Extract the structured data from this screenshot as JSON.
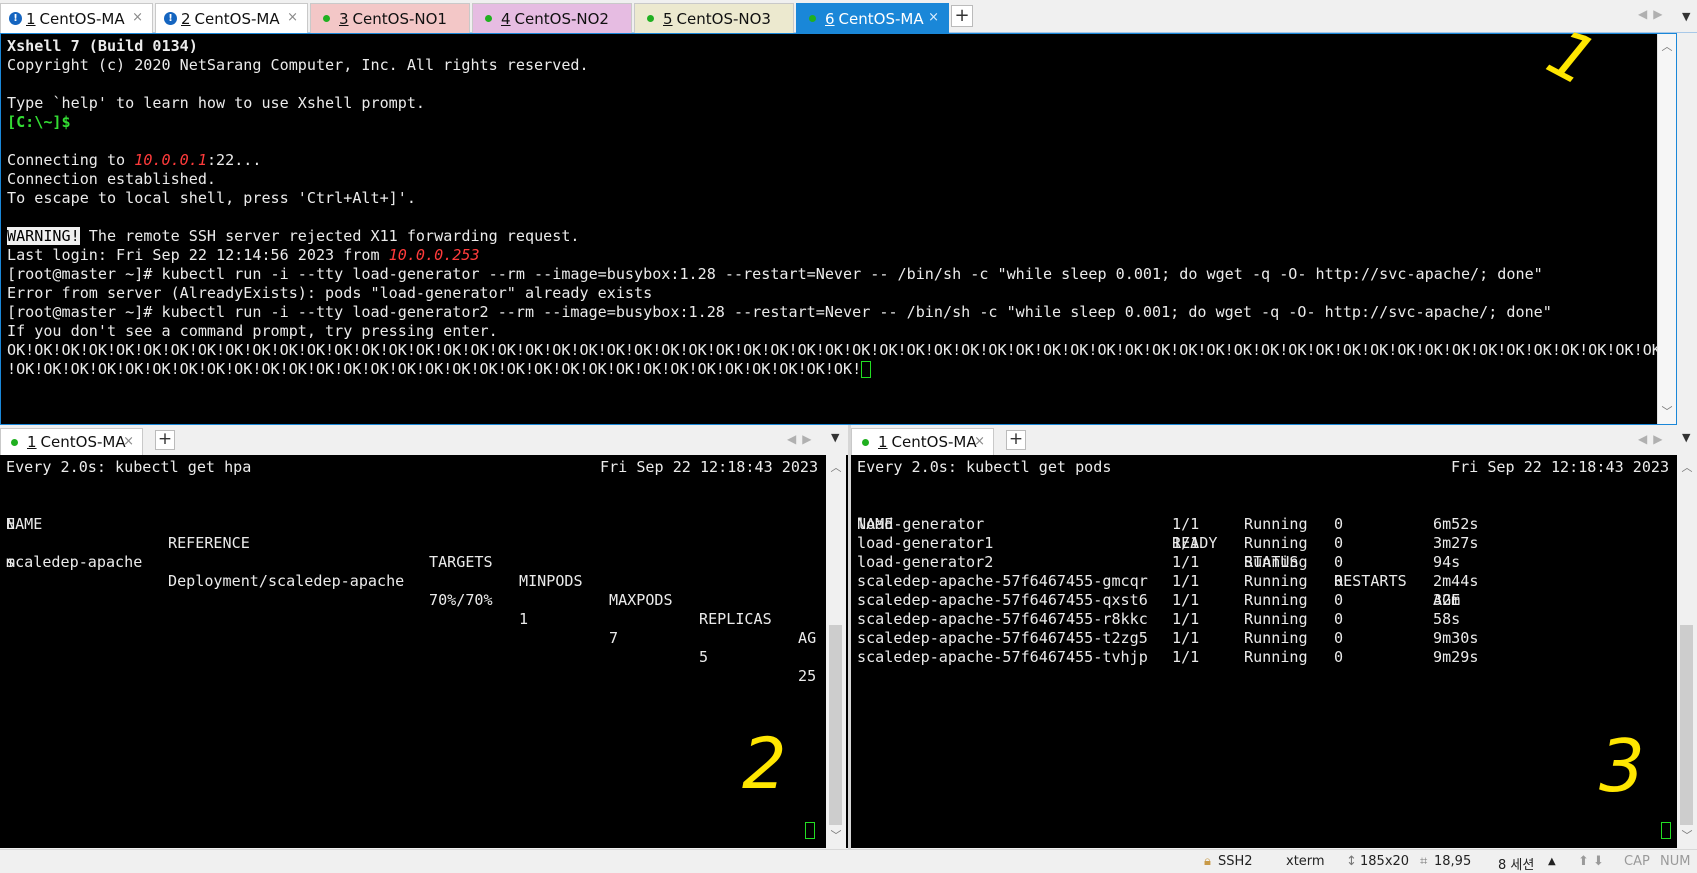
{
  "top_tabs": [
    {
      "num": "1",
      "label": "CentOS-MA",
      "bg": "#ffffff",
      "indicator": "alert-icon"
    },
    {
      "num": "2",
      "label": "CentOS-MA",
      "bg": "#ffffff",
      "indicator": "alert-icon"
    },
    {
      "num": "3",
      "label": "CentOS-NO1",
      "bg": "#f3c7c7",
      "indicator": "green-dot"
    },
    {
      "num": "4",
      "label": "CentOS-NO2",
      "bg": "#e6bce2",
      "indicator": "green-dot"
    },
    {
      "num": "5",
      "label": "CentOS-NO3",
      "bg": "#ece9cf",
      "indicator": "green-dot"
    },
    {
      "num": "6",
      "label": "CentOS-MA",
      "bg": "#1a87d8",
      "indicator": "green-dot",
      "active": true
    }
  ],
  "tab_close": "×",
  "tab_add": "+",
  "terminal1": {
    "header_line1": "Xshell 7 (Build 0134)",
    "header_line2": "Copyright (c) 2020 NetSarang Computer, Inc. All rights reserved.",
    "help_line": "Type `help' to learn how to use Xshell prompt.",
    "local_prompt": "[C:\\~]$",
    "connecting_prefix": "Connecting to ",
    "connecting_host": "10.0.0.1",
    "connecting_suffix": ":22...",
    "established": "Connection established.",
    "escape": "To escape to local shell, press 'Ctrl+Alt+]'.",
    "warning_tag": "WARNING!",
    "warning_text": " The remote SSH server rejected X11 forwarding request.",
    "last_login_prefix": "Last login: Fri Sep 22 12:14:56 2023 from ",
    "last_login_host": "10.0.0.253",
    "cmd1": "[root@master ~]# kubectl run -i --tty load-generator --rm --image=busybox:1.28 --restart=Never -- /bin/sh -c \"while sleep 0.001; do wget -q -O- http://svc-apache/; done\"",
    "error1": "Error from server (AlreadyExists): pods \"load-generator\" already exists",
    "cmd2": "[root@master ~]# kubectl run -i --tty load-generator2 --rm --image=busybox:1.28 --restart=Never -- /bin/sh -c \"while sleep 0.001; do wget -q -O- http://svc-apache/; done\"",
    "hint": "If you don't see a command prompt, try pressing enter.",
    "ok_line1": "OK!OK!OK!OK!OK!OK!OK!OK!OK!OK!OK!OK!OK!OK!OK!OK!OK!OK!OK!OK!OK!OK!OK!OK!OK!OK!OK!OK!OK!OK!OK!OK!OK!OK!OK!OK!OK!OK!OK!OK!OK!OK!OK!OK!OK!OK!OK!OK!OK!OK!OK!OK!OK!OK!OK!OK!OK!OK!OK!OK!OK!OK!OK!OK!OK!OK!OK!OK!OK!OK!OK!OK!OK!OK!OK!OK!OK!OK!OK!OK!OK!OK!OK!OK!OK!OK!OK!OK!OK!OK!OK!OK!OK",
    "ok_line2": "!OK!OK!OK!OK!OK!OK!OK!OK!OK!OK!OK!OK!OK!OK!OK!OK!OK!OK!OK!OK!OK!OK!OK!OK!OK!OK!OK!OK!OK!OK!OK!",
    "annotation": "1"
  },
  "pane2": {
    "tab": {
      "num": "1",
      "label": "CentOS-MA"
    },
    "watch_left": "Every 2.0s: kubectl get hpa",
    "watch_right": "Fri Sep 22 12:18:43 2023",
    "headers": [
      "NAME",
      "REFERENCE",
      "TARGETS",
      "MINPODS",
      "MAXPODS",
      "REPLICAS",
      "AG"
    ],
    "header_wrap": "E",
    "row": [
      "scaledep-apache",
      "Deployment/scaledep-apache",
      "70%/70%",
      "1",
      "7",
      "5",
      "25"
    ],
    "row_wrap": "m",
    "annotation": "2"
  },
  "pane3": {
    "tab": {
      "num": "1",
      "label": "CentOS-MA"
    },
    "watch_left": "Every 2.0s: kubectl get pods",
    "watch_right": "Fri Sep 22 12:18:43 2023",
    "headers": [
      "NAME",
      "READY",
      "STATUS",
      "RESTARTS",
      "AGE"
    ],
    "rows": [
      [
        "load-generator",
        "1/1",
        "Running",
        "0",
        "6m52s"
      ],
      [
        "load-generator1",
        "1/1",
        "Running",
        "0",
        "3m27s"
      ],
      [
        "load-generator2",
        "1/1",
        "Running",
        "0",
        "94s"
      ],
      [
        "scaledep-apache-57f6467455-gmcqr",
        "1/1",
        "Running",
        "0",
        "2m44s"
      ],
      [
        "scaledep-apache-57f6467455-qxst6",
        "1/1",
        "Running",
        "0",
        "32m"
      ],
      [
        "scaledep-apache-57f6467455-r8kkc",
        "1/1",
        "Running",
        "0",
        "58s"
      ],
      [
        "scaledep-apache-57f6467455-t2zg5",
        "1/1",
        "Running",
        "0",
        "9m30s"
      ],
      [
        "scaledep-apache-57f6467455-tvhjp",
        "1/1",
        "Running",
        "0",
        "9m29s"
      ]
    ],
    "annotation": "3"
  },
  "status": {
    "protocol": "SSH2",
    "term_type": "xterm",
    "size": "185x20",
    "cursor_pos": "18,95",
    "sessions": "8 세션",
    "cap": "CAP",
    "num": "NUM"
  }
}
